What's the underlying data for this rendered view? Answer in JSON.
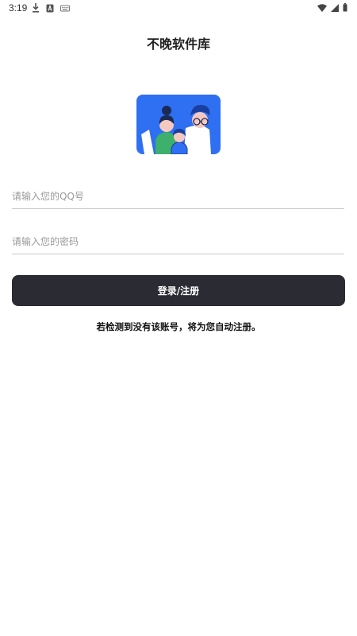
{
  "status_bar": {
    "time": "3:19",
    "left_icons": [
      "download-icon",
      "app-a-icon",
      "keyboard-icon"
    ],
    "right_icons": [
      "wifi-icon",
      "signal-icon",
      "battery-icon"
    ]
  },
  "header": {
    "title": "不晚软件库"
  },
  "hero": {
    "icon": "family-illustration-icon",
    "background_color": "#2f6ff2"
  },
  "form": {
    "qq_placeholder": "请输入您的QQ号",
    "qq_value": "",
    "password_placeholder": "请输入您的密码",
    "password_value": "",
    "submit_label": "登录/注册",
    "submit_color": "#2b2b33"
  },
  "hint": {
    "text": "若检测到没有该账号，将为您自动注册。"
  }
}
